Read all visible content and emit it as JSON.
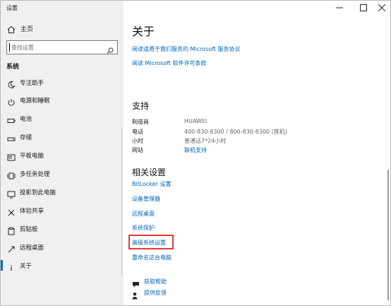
{
  "window": {
    "title": "设置",
    "controls": {
      "minimize_icon": "minimize-icon",
      "maximize_icon": "maximize-icon",
      "close_icon": "close-icon"
    }
  },
  "sidebar": {
    "home_label": "主页",
    "search_placeholder": "查找设置",
    "section_title": "系统",
    "items": [
      {
        "label": "专注助手",
        "icon": "moon-icon"
      },
      {
        "label": "电源和睡眠",
        "icon": "power-icon"
      },
      {
        "label": "电池",
        "icon": "battery-icon"
      },
      {
        "label": "存储",
        "icon": "storage-icon"
      },
      {
        "label": "平板电脑",
        "icon": "tablet-icon"
      },
      {
        "label": "多任务处理",
        "icon": "multitask-icon"
      },
      {
        "label": "投影到此电脑",
        "icon": "project-icon"
      },
      {
        "label": "体验共享",
        "icon": "share-icon"
      },
      {
        "label": "剪贴板",
        "icon": "clipboard-icon"
      },
      {
        "label": "远程桌面",
        "icon": "remote-icon"
      },
      {
        "label": "关于",
        "icon": "info-icon",
        "active": true
      }
    ]
  },
  "main": {
    "title": "关于",
    "top_links": [
      "阅读适用于我们服务的 Microsoft 服务协议",
      "阅读 Microsoft 软件许可条款"
    ],
    "support": {
      "title": "支持",
      "rows": [
        {
          "label": "制造商",
          "value": "HUAWEI"
        },
        {
          "label": "电话",
          "value": "400-830-8300 / 800-830-8300 (座机)"
        },
        {
          "label": "小时",
          "value": "普通话7*24小时"
        },
        {
          "label": "网站",
          "value": "联机支持"
        }
      ]
    },
    "related": {
      "title": "相关设置",
      "links": [
        "BitLocker 设置",
        "设备管理器",
        "远程桌面",
        "系统保护",
        "高级系统设置",
        "重命名这台电脑"
      ]
    },
    "help": {
      "get_help": "获取帮助",
      "feedback": "提供反馈"
    }
  },
  "colors": {
    "accent": "#0067c0",
    "link": "#0066b4",
    "sidebar_bg": "#f0f0f0",
    "highlight_border": "#e53935"
  }
}
